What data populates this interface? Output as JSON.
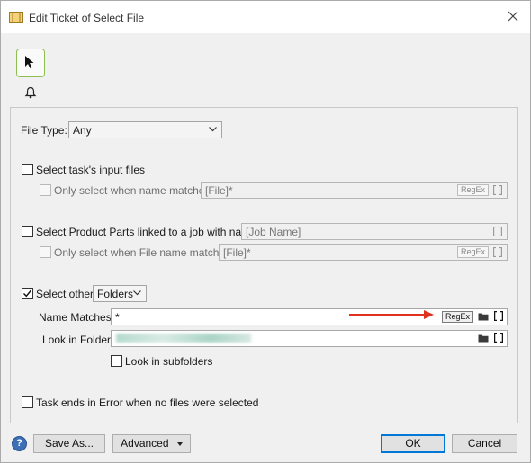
{
  "window": {
    "title": "Edit Ticket of Select File"
  },
  "file_type": {
    "label": "File Type:",
    "value": "Any"
  },
  "input_files": {
    "checkbox_label": "Select task's input files",
    "checked": false,
    "name_match_label": "Only select when name matches:",
    "name_match_value": "[File]*",
    "regex_label": "RegEx",
    "brackets": "[ ]"
  },
  "product_parts": {
    "checkbox_label": "Select Product Parts linked to a job with name:",
    "checked": false,
    "job_name_value": "[Job Name]",
    "file_match_label": "Only select when File name matches:",
    "file_match_value": "[File]*",
    "regex_label": "RegEx",
    "brackets": "[ ]"
  },
  "select_other": {
    "checkbox_label": "Select other",
    "checked": true,
    "type_value": "Folders",
    "name_matches_label": "Name Matches:",
    "name_matches_value": "*",
    "regex_label": "RegEx",
    "look_in_folder_label": "Look in Folder:",
    "subfolders_label": "Look in subfolders",
    "subfolders_checked": false,
    "brackets": "[ ]"
  },
  "error_option": {
    "checkbox_label": "Task ends in Error when no files were selected",
    "checked": false
  },
  "footer": {
    "help_label": "?",
    "save_as_label": "Save As...",
    "advanced_label": "Advanced",
    "ok_label": "OK",
    "cancel_label": "Cancel"
  },
  "colors": {
    "accent": "#0078d7",
    "annotation_arrow": "#e0301e",
    "tool_border": "#8cbf4f"
  }
}
